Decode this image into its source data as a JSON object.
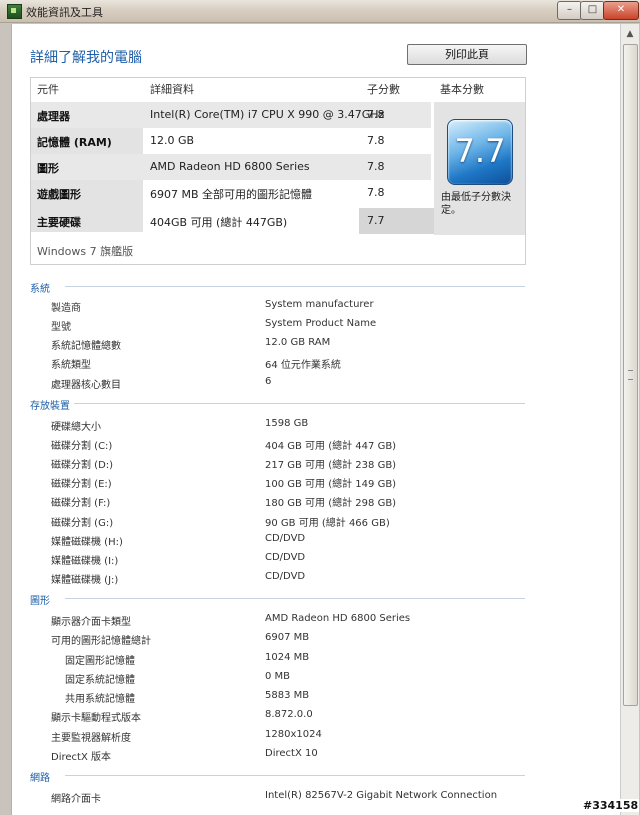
{
  "window": {
    "title": "效能資訊及工具",
    "controls": {
      "minimize": "–",
      "maximize": "□",
      "close": "✕"
    }
  },
  "header": {
    "title": "詳細了解我的電腦",
    "print_label": "列印此頁"
  },
  "score_table": {
    "columns": [
      "元件",
      "詳細資料",
      "子分數",
      "基本分數"
    ],
    "rows": [
      {
        "component": "處理器",
        "details": "Intel(R) Core(TM) i7 CPU X 990 @ 3.47GHz",
        "subscore": "7.8"
      },
      {
        "component": "記憶體 (RAM)",
        "details": "12.0 GB",
        "subscore": "7.8"
      },
      {
        "component": "圖形",
        "details": "AMD Radeon HD 6800 Series",
        "subscore": "7.8"
      },
      {
        "component": "遊戲圖形",
        "details": "6907 MB 全部可用的圖形記憶體",
        "subscore": "7.8"
      },
      {
        "component": "主要硬碟",
        "details": "404GB 可用 (總計 447GB)",
        "subscore": "7.7"
      }
    ],
    "base_score": "7.7",
    "base_note": "由最低子分數決定。",
    "edition": "Windows 7 旗艦版"
  },
  "sections": [
    {
      "title": "系統",
      "items": [
        {
          "label": "製造商",
          "value": "System manufacturer"
        },
        {
          "label": "型號",
          "value": "System Product Name"
        },
        {
          "label": "系統記憶體總數",
          "value": "12.0 GB RAM"
        },
        {
          "label": "系統類型",
          "value": "64 位元作業系統"
        },
        {
          "label": "處理器核心數目",
          "value": "6"
        }
      ]
    },
    {
      "title": "存放裝置",
      "items": [
        {
          "label": "硬碟總大小",
          "value": "1598 GB"
        },
        {
          "label": "磁碟分割 (C:)",
          "value": "404 GB 可用 (總計 447 GB)"
        },
        {
          "label": "磁碟分割 (D:)",
          "value": "217 GB 可用 (總計 238 GB)"
        },
        {
          "label": "磁碟分割 (E:)",
          "value": "100 GB 可用 (總計 149 GB)"
        },
        {
          "label": "磁碟分割 (F:)",
          "value": "180 GB 可用 (總計 298 GB)"
        },
        {
          "label": "磁碟分割 (G:)",
          "value": "90 GB 可用 (總計 466 GB)"
        },
        {
          "label": "媒體磁碟機 (H:)",
          "value": "CD/DVD"
        },
        {
          "label": "媒體磁碟機 (I:)",
          "value": "CD/DVD"
        },
        {
          "label": "媒體磁碟機 (J:)",
          "value": "CD/DVD"
        }
      ]
    },
    {
      "title": "圖形",
      "items": [
        {
          "label": "顯示器介面卡類型",
          "value": "AMD Radeon HD 6800 Series"
        },
        {
          "label": "可用的圖形記憶體總計",
          "value": "6907 MB"
        },
        {
          "label": "固定圖形記憶體",
          "value": "1024 MB"
        },
        {
          "label": "固定系統記憶體",
          "value": "0 MB"
        },
        {
          "label": "共用系統記憶體",
          "value": "5883 MB"
        },
        {
          "label": "顯示卡驅動程式版本",
          "value": "8.872.0.0"
        },
        {
          "label": "主要監視器解析度",
          "value": "1280x1024"
        },
        {
          "label": "DirectX 版本",
          "value": "DirectX 10"
        }
      ]
    },
    {
      "title": "網路",
      "items": [
        {
          "label": "網路介面卡",
          "value": "Intel(R) 82567V-2 Gigabit Network Connection"
        }
      ]
    }
  ],
  "watermark": "#334158"
}
